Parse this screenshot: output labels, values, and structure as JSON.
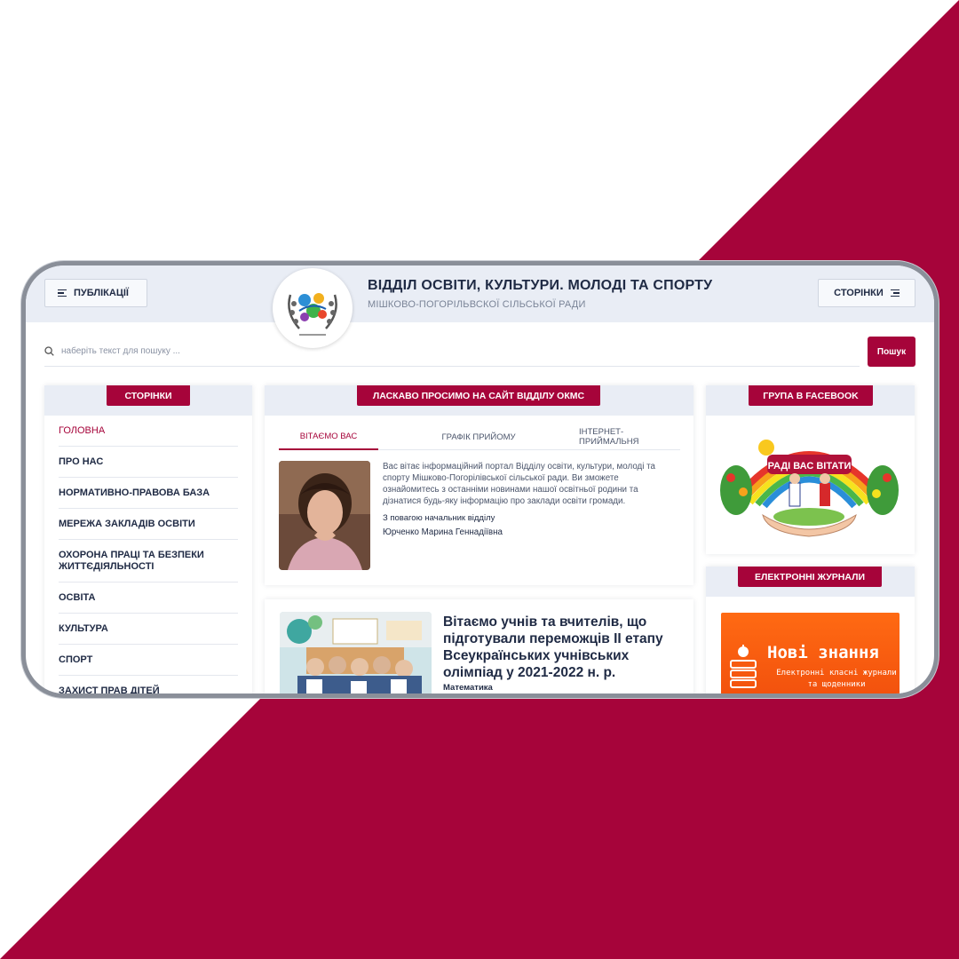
{
  "colors": {
    "accent": "#a6043a",
    "header_bg": "#e9edf5",
    "text": "#1f2a44"
  },
  "header": {
    "publications_label": "ПУБЛІКАЦІЇ",
    "pages_label": "СТОРІНКИ",
    "title": "ВІДДІЛ ОСВІТИ, КУЛЬТУРИ. МОЛОДІ ТА СПОРТУ",
    "subtitle": "МІШКОВО-ПОГОРІЛЬВСКОЇ СІЛЬСЬКОЇ РАДИ"
  },
  "search": {
    "placeholder": "наберіть текст для пошуку ...",
    "button_label": "Пошук"
  },
  "sidebar": {
    "title": "СТОРІНКИ",
    "items": [
      {
        "label": "ГОЛОВНА"
      },
      {
        "label": "ПРО НАС"
      },
      {
        "label": "НОРМАТИВНО-ПРАВОВА БАЗА"
      },
      {
        "label": "МЕРЕЖА ЗАКЛАДІВ ОСВІТИ"
      },
      {
        "label": "ОХОРОНА ПРАЦІ ТА БЕЗПЕКИ ЖИТТЄДІЯЛЬНОСТІ"
      },
      {
        "label": "ОСВІТА"
      },
      {
        "label": "КУЛЬТУРА"
      },
      {
        "label": "СПОРТ"
      },
      {
        "label": "ЗАХИСТ ПРАВ ДІТЕЙ"
      }
    ]
  },
  "welcome": {
    "title": "ЛАСКАВО ПРОСИМО НА САЙТ ВІДДІЛУ ОКМС",
    "tabs": [
      "ВІТАЄМО ВАС",
      "ГРАФІК ПРИЙОМУ",
      "ІНТЕРНЕТ-ПРИЙМАЛЬНЯ"
    ],
    "text": "Вас вітає інформаційний портал Відділу освіти, культури, молоді та спорту Мішково-Погорілівської сільської ради. Ви зможете ознайомитесь з останніми новинами нашої освітньої родини та дізнатися будь-яку інформацію про заклади освіти громади.",
    "regards": "З повагою начальник відділу",
    "signature": "Юрченко Марина Геннадіївна"
  },
  "news": {
    "title": "Вітаємо учнів та вчителів, що підготували переможців ІІ етапу Всеукраїнських учнівських олімпіад у 2021-2022 н. р.",
    "category": "Математика"
  },
  "facebook": {
    "title": "ГРУПА В FACEBOOK",
    "image_text": "РАДІ ВАС ВІТАТИ"
  },
  "journals": {
    "title": "ЕЛЕКТРОННІ ЖУРНАЛИ",
    "banner_title": "Нові знання",
    "banner_sub": "Електронні класні журнали та щоденники"
  }
}
